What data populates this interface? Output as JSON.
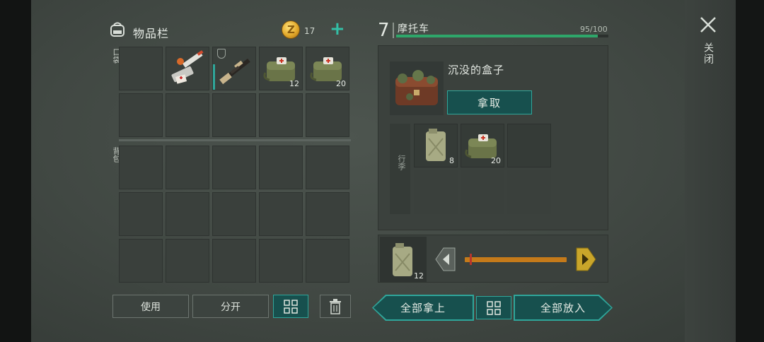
{
  "inventory": {
    "title": "物品栏",
    "coins": "17",
    "pocket_label": "口袋",
    "backpack_label": "背包",
    "pocket_slots": [
      {
        "item": "",
        "qty": ""
      },
      {
        "item": "syringe-kit-icon",
        "qty": ""
      },
      {
        "item": "rifle-icon",
        "qty": ""
      },
      {
        "item": "medkit-bag-icon",
        "qty": "12"
      },
      {
        "item": "medkit-bag-icon",
        "qty": "20"
      }
    ],
    "buttons": {
      "use": "使用",
      "split": "分开"
    }
  },
  "vehicle": {
    "level": "7",
    "name": "摩托车",
    "durability": "95/100",
    "durability_fraction": 0.95,
    "container_name": "沉没的盒子",
    "take_label": "拿取",
    "luggage_label": "行李",
    "container_slots": [
      {
        "item": "jerry-can-icon",
        "qty": "8"
      },
      {
        "item": "medkit-bag-icon",
        "qty": "20"
      }
    ]
  },
  "split_panel": {
    "item": "jerry-can-icon",
    "qty": "12",
    "slider_fraction": 0.05
  },
  "actions": {
    "take_all": "全部拿上",
    "put_all": "全部放入"
  },
  "close": {
    "label": "关闭"
  },
  "colors": {
    "accent": "#2fa69a",
    "button_fill": "#17504e",
    "slider": "#c57a1a",
    "hp": "#2ea66a"
  }
}
